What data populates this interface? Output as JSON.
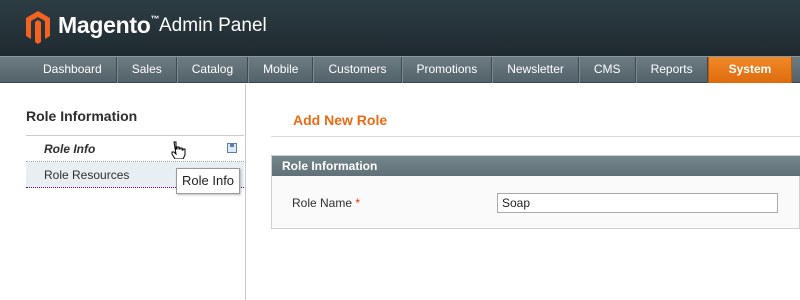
{
  "header": {
    "brand": "Magento",
    "brand_tm": "™",
    "subtitle": "Admin Panel",
    "logo_icon": "magento-hex-logo-icon",
    "logo_color": "#f26322"
  },
  "nav": {
    "items": [
      "Dashboard",
      "Sales",
      "Catalog",
      "Mobile",
      "Customers",
      "Promotions",
      "Newsletter",
      "CMS",
      "Reports",
      "System"
    ],
    "active": "System",
    "active_color": "#eb6a14"
  },
  "sidebar": {
    "title": "Role Information",
    "tabs": [
      {
        "label": "Role Info",
        "active": true,
        "icon": "save-icon"
      },
      {
        "label": "Role Resources",
        "active": false
      }
    ],
    "tooltip": "Role Info",
    "cursor_icon": "hand-pointer-icon"
  },
  "main": {
    "page_title": "Add New Role",
    "fieldset_title": "Role Information",
    "role_name_label": "Role Name",
    "required_marker": "*",
    "role_name_value": "Soap",
    "accent_color": "#eb6a14"
  }
}
